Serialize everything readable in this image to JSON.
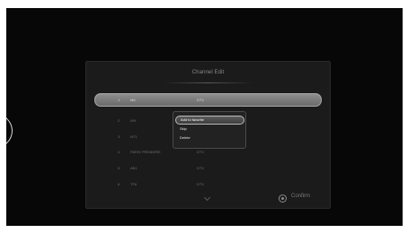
{
  "dialog": {
    "title": "Channel Edit",
    "footer": {
      "confirm_label": "Confirm"
    }
  },
  "channels": [
    {
      "number": "1",
      "name": "M6",
      "type": "DTV"
    },
    {
      "number": "2",
      "name": "W9",
      "type": ""
    },
    {
      "number": "3",
      "name": "NT1",
      "type": ""
    },
    {
      "number": "4",
      "name": "PARIS PREMIERE",
      "type": "DTV"
    },
    {
      "number": "5",
      "name": "AB1",
      "type": "DTV"
    },
    {
      "number": "6",
      "name": "TF6",
      "type": "DTV"
    }
  ],
  "context_menu": {
    "items": [
      {
        "label": "Add to favorite"
      },
      {
        "label": "Skip"
      },
      {
        "label": "Delete"
      }
    ]
  },
  "colors": {
    "screen_background": "#070707",
    "panel_background": "#1b1b1b",
    "selection": "#8e8e8e"
  }
}
